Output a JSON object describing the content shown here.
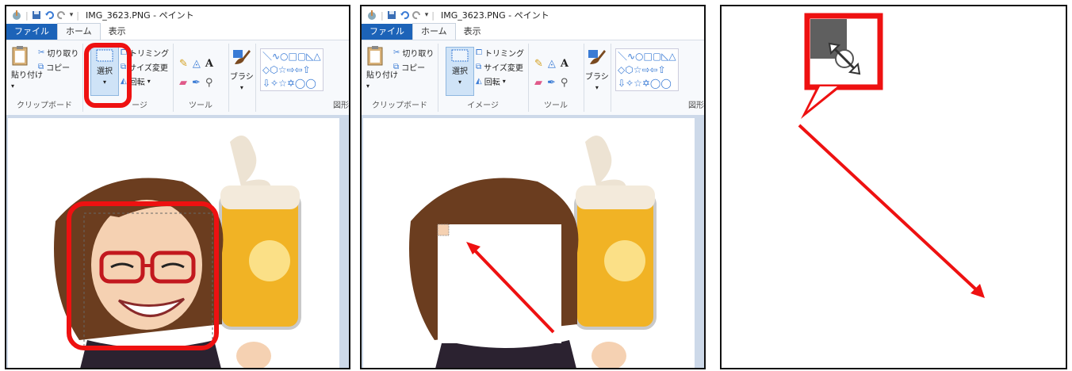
{
  "window": {
    "title": "IMG_3623.PNG - ペイント"
  },
  "tabs": {
    "file": "ファイル",
    "home": "ホーム",
    "view": "表示"
  },
  "clipboard": {
    "paste": "貼り付け",
    "cut": "切り取り",
    "copy": "コピー",
    "group_label": "クリップボード"
  },
  "image": {
    "select": "選択",
    "trim": "トリミング",
    "resize": "サイズ変更",
    "rotate": "回転",
    "group_label": "イメージ",
    "group_label_partial": "ージ"
  },
  "tools": {
    "group_label": "ツール"
  },
  "brush": {
    "label": "ブラシ"
  },
  "shapes": {
    "group_label": "図形",
    "group_label_partial": "図形"
  },
  "colors": {
    "highlight": "#ee1111",
    "file_tab": "#1c63b8",
    "canvas_bg": "#cdd9e9"
  },
  "icons": [
    "paint-app-icon",
    "save-icon",
    "undo-icon",
    "redo-icon",
    "paste-icon",
    "scissors-icon",
    "copy-icon",
    "select-rectangle-icon",
    "crop-icon",
    "resize-icon",
    "rotate-icon",
    "pencil-icon",
    "fill-icon",
    "text-icon",
    "eraser-icon",
    "color-picker-icon",
    "magnifier-icon",
    "brush-icon",
    "shapes-gallery-icon",
    "resize-cursor-icon"
  ]
}
